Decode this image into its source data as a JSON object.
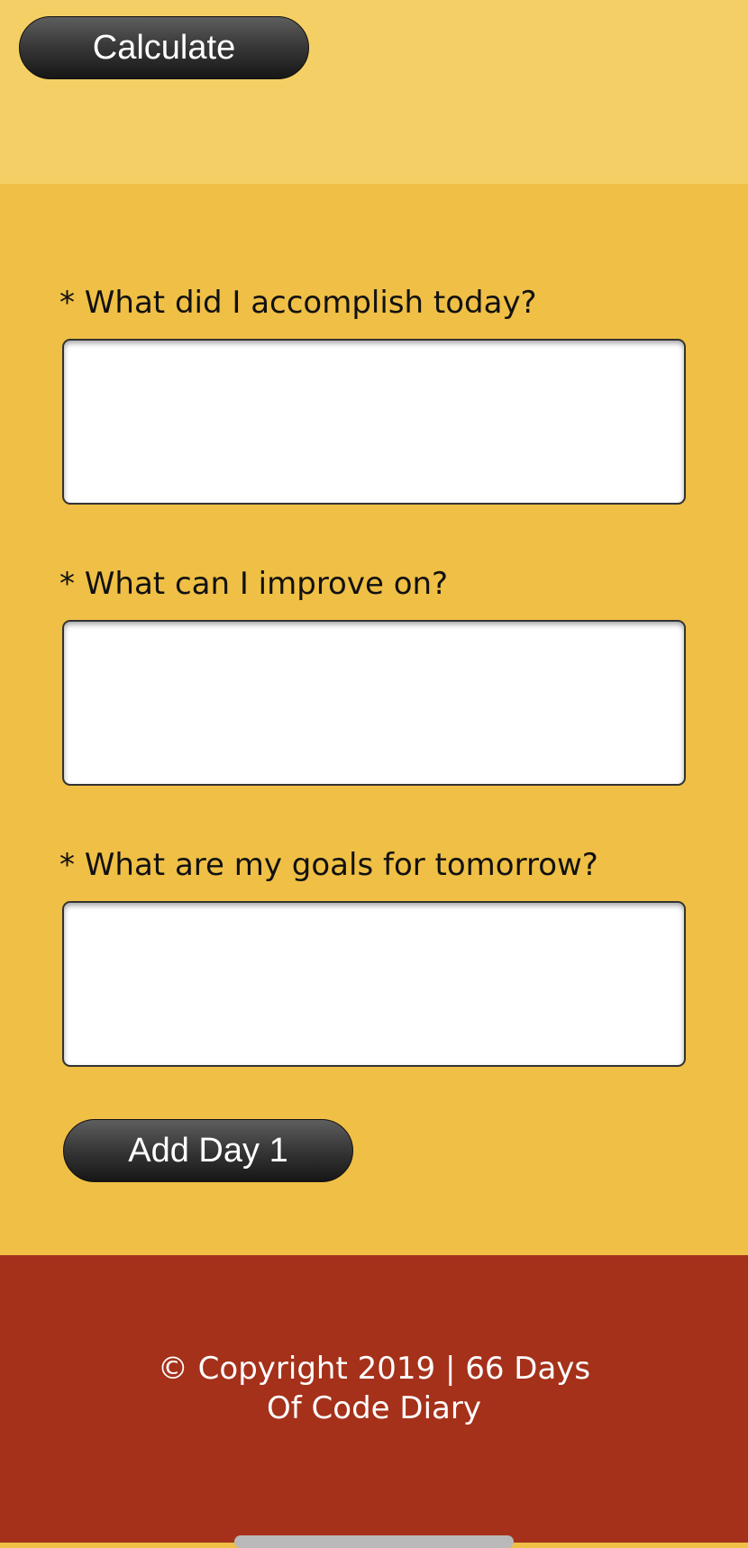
{
  "header": {
    "calculate_label": "Calculate"
  },
  "form": {
    "fields": [
      {
        "label": "* What did I accomplish today?",
        "value": ""
      },
      {
        "label": "* What can I improve on?",
        "value": ""
      },
      {
        "label": "* What are my goals for tomorrow?",
        "value": ""
      }
    ],
    "submit_label": "Add Day 1"
  },
  "footer": {
    "line1": "© Copyright 2019 | 66 Days",
    "line2": "Of Code Diary"
  },
  "colors": {
    "top_band": "#f3cf65",
    "form_background": "#efbf46",
    "footer_background": "#a5311b",
    "button_dark": "#2a2a2a"
  }
}
